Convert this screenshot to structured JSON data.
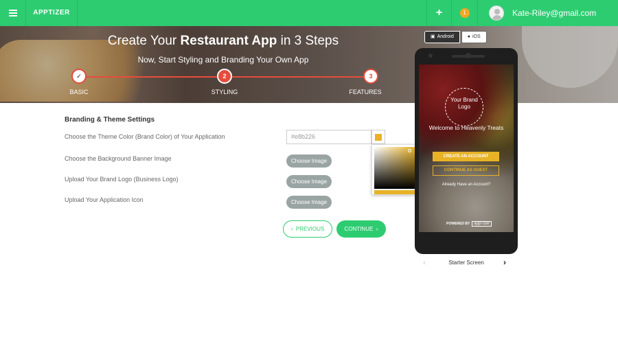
{
  "colors": {
    "accent": "#2ecc71",
    "step": "#e74c3c",
    "theme": "#e8b226",
    "badge": "#f5a623"
  },
  "topbar": {
    "brand": "APPTIZER",
    "plus_icon": "+",
    "notifications": "1",
    "user_email": "Kate-Riley@gmail.com"
  },
  "hero": {
    "title_pre": "Create Your ",
    "title_bold": "Restaurant App",
    "title_post": " in 3 Steps",
    "subtitle": "Now, Start Styling and Branding Your Own App",
    "steps": [
      {
        "num": "✓",
        "label": "BASIC",
        "state": "done"
      },
      {
        "num": "2",
        "label": "STYLING",
        "state": "active"
      },
      {
        "num": "3",
        "label": "FEATURES",
        "state": "pending"
      }
    ]
  },
  "form": {
    "section_title": "Branding & Theme Settings",
    "theme_color_label": "Choose the Theme Color (Brand Color) of Your Application",
    "theme_color_value": "#e8b226",
    "banner_label": "Choose the Background Banner Image",
    "logo_label": "Upload Your Brand Logo (Business Logo)",
    "icon_label": "Upload Your Application Icon",
    "choose_image": "Choose Image",
    "previous": "PREVIOUS",
    "continue": "CONTINUE"
  },
  "preview": {
    "platforms": [
      "Android",
      "iOS"
    ],
    "active_platform": "Android",
    "logo_text": "Your Brand Logo",
    "welcome": "Welcome to Heavenly Treats",
    "create_account": "CREATE AN ACCOUNT",
    "continue_guest": "CONTINUE AS GUEST",
    "have_account": "Already Have an Account?",
    "powered_by": "POWERED BY",
    "powered_mark": "appTizer",
    "screen_name": "Starter Screen"
  }
}
